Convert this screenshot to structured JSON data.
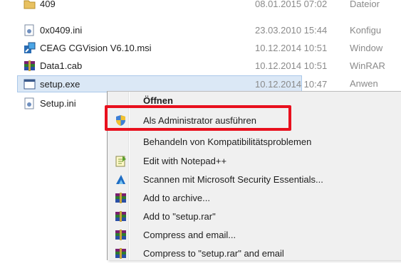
{
  "files": [
    {
      "name": "409",
      "date": "08.01.2015 07:02",
      "type": "Dateior",
      "icon": "folder-icon"
    },
    {
      "name": "0x0409.ini",
      "date": "23.03.2010 15:44",
      "type": "Konfigu",
      "icon": "ini-file-icon"
    },
    {
      "name": "CEAG CGVision V6.10.msi",
      "date": "10.12.2014 10:51",
      "type": "Window",
      "icon": "msi-installer-icon"
    },
    {
      "name": "Data1.cab",
      "date": "10.12.2014 10:51",
      "type": "WinRAR",
      "icon": "winrar-archive-icon"
    },
    {
      "name": "setup.exe",
      "date": "10.12.2014 10:47",
      "type": "Anwen",
      "icon": "exe-app-icon"
    },
    {
      "name": "Setup.ini",
      "date": "",
      "type": "",
      "icon": "ini-file-icon"
    }
  ],
  "context_menu": {
    "items": [
      {
        "label": "Öffnen",
        "icon": ""
      },
      {
        "label": "Als Administrator ausführen",
        "icon": "uac-shield-icon"
      },
      {
        "label": "Behandeln von Kompatibilitätsproblemen",
        "icon": ""
      },
      {
        "label": "Edit with Notepad++",
        "icon": "notepad-plus-plus-icon"
      },
      {
        "label": "Scannen mit Microsoft Security Essentials...",
        "icon": "security-essentials-icon"
      },
      {
        "label": "Add to archive...",
        "icon": "winrar-icon"
      },
      {
        "label": "Add to \"setup.rar\"",
        "icon": "winrar-icon"
      },
      {
        "label": "Compress and email...",
        "icon": "winrar-icon"
      },
      {
        "label": "Compress to \"setup.rar\" and email",
        "icon": "winrar-icon"
      }
    ]
  },
  "colors": {
    "highlight": "#e8101e",
    "selection": "#dbe8f6"
  }
}
